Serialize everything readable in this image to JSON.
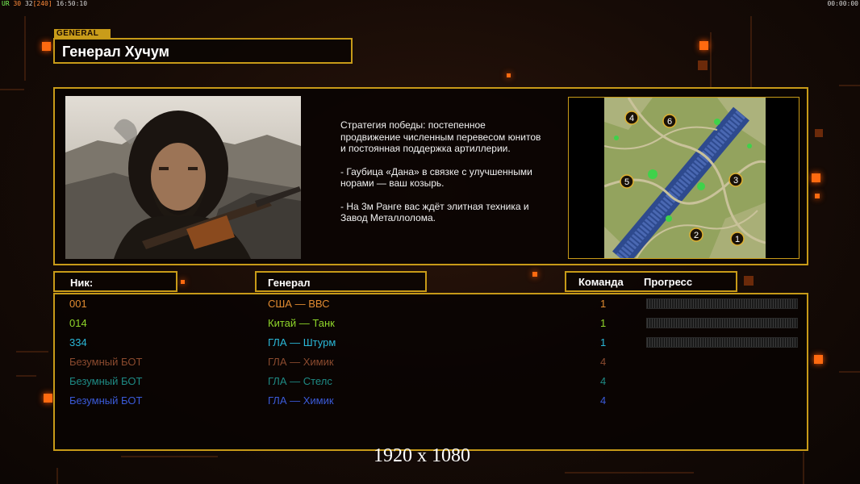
{
  "hud": {
    "top_left_prefix": "UR",
    "top_left_fps": "30",
    "top_left_num": "32",
    "top_left_bracket": "[240]",
    "top_left_time": "16:50:10",
    "top_right_time": "00:00:00"
  },
  "general_tag": "GENERAL",
  "general_name": "Генерал Хучум",
  "strategy": {
    "paragraph1": "Стратегия победы: постепенное продвижение численным перевесом юнитов и постоянная поддержка артиллерии.",
    "paragraph2": "- Гаубица «Дана» в связке с улучшенными норами — ваш козырь.",
    "paragraph3": "- На 3м Ранге вас ждёт элитная техника и Завод Металлолома."
  },
  "map_spawns": [
    "1",
    "2",
    "3",
    "4",
    "5",
    "6"
  ],
  "columns": {
    "nick": "Ник:",
    "general": "Генерал",
    "team": "Команда",
    "progress": "Прогресс"
  },
  "players": [
    {
      "nick": "001",
      "general": "США — ВВС",
      "team": "1",
      "color": "#e08a30",
      "has_progress": true
    },
    {
      "nick": "014",
      "general": "Китай — Танк",
      "team": "1",
      "color": "#8fd62a",
      "has_progress": true
    },
    {
      "nick": "334",
      "general": "ГЛА — Штурм",
      "team": "1",
      "color": "#2ab8d8",
      "has_progress": true
    },
    {
      "nick": "Безумный БОТ",
      "general": "ГЛА — Химик",
      "team": "4",
      "color": "#8a4a2e",
      "has_progress": false
    },
    {
      "nick": "Безумный БОТ",
      "general": "ГЛА — Стелс",
      "team": "4",
      "color": "#1e8a84",
      "has_progress": false
    },
    {
      "nick": "Безумный БОТ",
      "general": "ГЛА — Химик",
      "team": "4",
      "color": "#3a5ad8",
      "has_progress": false
    }
  ],
  "resolution_label": "1920 x 1080",
  "colors": {
    "accent_gold": "#c79a18",
    "accent_orange": "#ff6a10"
  }
}
